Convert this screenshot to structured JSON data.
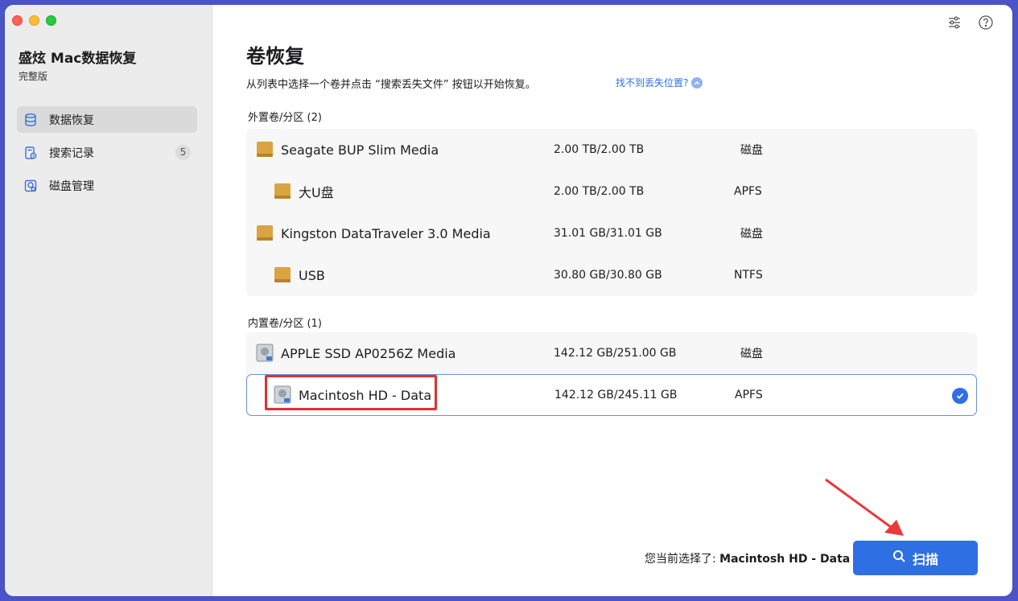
{
  "app": {
    "title": "盛炫 Mac数据恢复",
    "edition": "完整版"
  },
  "sidebar": {
    "items": [
      {
        "label": "数据恢复",
        "icon": "database-icon",
        "active": true
      },
      {
        "label": "搜索记录",
        "icon": "history-icon",
        "badge": "5"
      },
      {
        "label": "磁盘管理",
        "icon": "disk-manage-icon"
      }
    ]
  },
  "toolbar": {
    "icons": [
      "settings-sliders-icon",
      "help-icon"
    ]
  },
  "main": {
    "title": "卷恢复",
    "description": "从列表中选择一个卷并点击 “搜索丢失文件” 按钮以开始恢复。",
    "help_link": "找不到丢失位置?",
    "external_label": "外置卷/分区 (2)",
    "internal_label": "内置卷/分区 (1)",
    "external": [
      {
        "name": "Seagate BUP Slim Media",
        "size": "2.00 TB/2.00 TB",
        "fs": "磁盘",
        "level": 0
      },
      {
        "name": "大U盘",
        "size": "2.00 TB/2.00 TB",
        "fs": "APFS",
        "level": 1
      },
      {
        "name": "Kingston DataTraveler 3.0 Media",
        "size": "31.01 GB/31.01 GB",
        "fs": "磁盘",
        "level": 0
      },
      {
        "name": "USB",
        "size": "30.80 GB/30.80 GB",
        "fs": "NTFS",
        "level": 1
      }
    ],
    "internal": [
      {
        "name": "APPLE SSD AP0256Z Media",
        "size": "142.12 GB/251.00 GB",
        "fs": "磁盘",
        "level": 0
      },
      {
        "name": "Macintosh HD - Data",
        "size": "142.12 GB/245.11 GB",
        "fs": "APFS",
        "level": 1,
        "selected": true
      }
    ]
  },
  "footer": {
    "selected_prefix": "您当前选择了: ",
    "selected_value": "Macintosh HD - Data",
    "scan_label": "扫描"
  },
  "colors": {
    "accent": "#2f6fe4",
    "highlight": "#e03030",
    "drive_external": "#d9a441"
  }
}
